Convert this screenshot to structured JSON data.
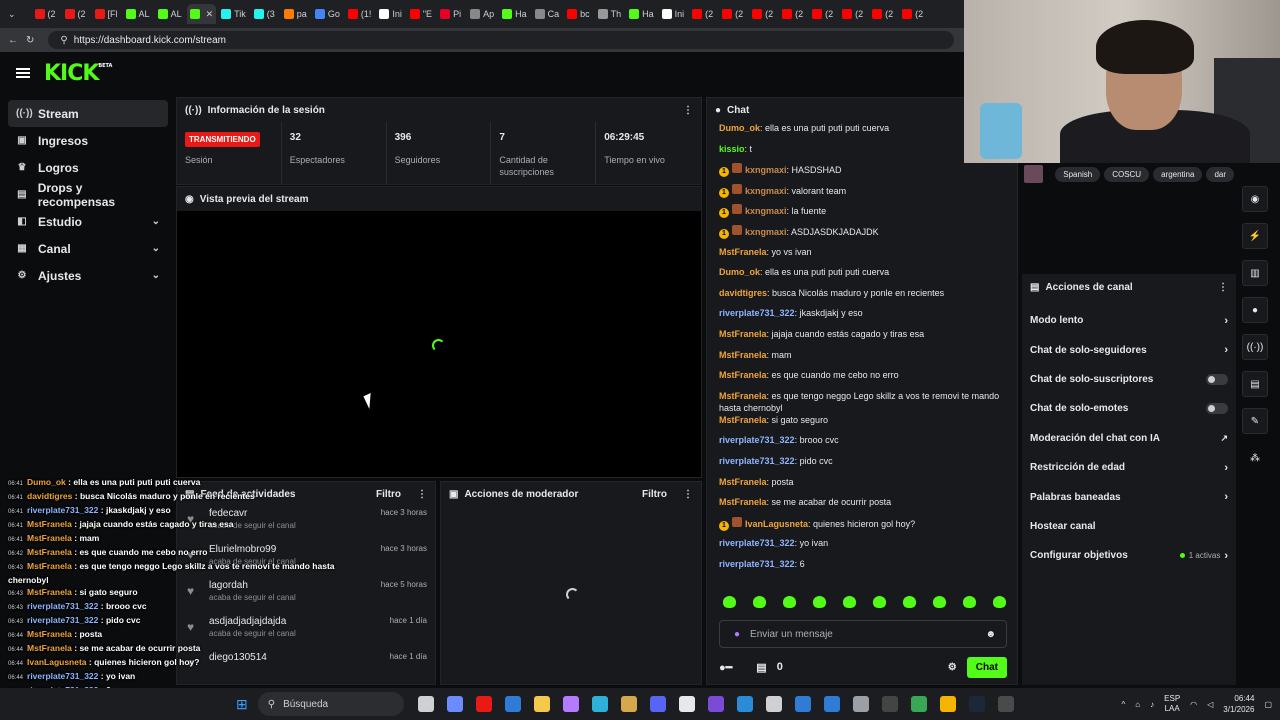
{
  "browser": {
    "tabs": [
      {
        "label": "(2",
        "color": "#e91916"
      },
      {
        "label": "(2",
        "color": "#e91916"
      },
      {
        "label": "[Fl",
        "color": "#e91916"
      },
      {
        "label": "AL",
        "color": "#53fc18"
      },
      {
        "label": "AL",
        "color": "#53fc18"
      },
      {
        "label": "",
        "color": "#53fc18"
      },
      {
        "label": "Tik",
        "color": "#25f4ee"
      },
      {
        "label": "(3",
        "color": "#25f4ee"
      },
      {
        "label": "pa",
        "color": "#ff7a00"
      },
      {
        "label": "Go",
        "color": "#4285f4"
      },
      {
        "label": "(1!",
        "color": "#ff0000"
      },
      {
        "label": "Ini",
        "color": "#ffffff"
      },
      {
        "label": "\"E",
        "color": "#ff0000"
      },
      {
        "label": "Pi",
        "color": "#e60023"
      },
      {
        "label": "Ap",
        "color": "#888888"
      },
      {
        "label": "Ha",
        "color": "#53fc18"
      },
      {
        "label": "Ca",
        "color": "#888888"
      },
      {
        "label": "bc",
        "color": "#ff0000"
      },
      {
        "label": "Th",
        "color": "#999999"
      },
      {
        "label": "Ha",
        "color": "#53fc18"
      },
      {
        "label": "Ini",
        "color": "#ffffff"
      },
      {
        "label": "(2",
        "color": "#ff0000"
      },
      {
        "label": "(2",
        "color": "#ff0000"
      },
      {
        "label": "(2",
        "color": "#ff0000"
      },
      {
        "label": "(2",
        "color": "#ff0000"
      },
      {
        "label": "(2",
        "color": "#ff0000"
      },
      {
        "label": "(2",
        "color": "#ff0000"
      },
      {
        "label": "(2",
        "color": "#ff0000"
      },
      {
        "label": "(2",
        "color": "#ff0000"
      }
    ],
    "url": "https://dashboard.kick.com/stream"
  },
  "kick": {
    "logo": "KICK",
    "beta": "BETA"
  },
  "nav": {
    "items": [
      {
        "label": "Stream",
        "icon": "broadcast-icon",
        "glyph": "((·))",
        "chevron": false,
        "active": true
      },
      {
        "label": "Ingresos",
        "icon": "wallet-icon",
        "glyph": "▣",
        "chevron": false,
        "active": false
      },
      {
        "label": "Logros",
        "icon": "trophy-icon",
        "glyph": "♛",
        "chevron": false,
        "active": false
      },
      {
        "label": "Drops y recompensas",
        "icon": "gift-icon",
        "glyph": "▤",
        "chevron": false,
        "active": false
      },
      {
        "label": "Estudio",
        "icon": "studio-icon",
        "glyph": "◧",
        "chevron": true,
        "active": false
      },
      {
        "label": "Canal",
        "icon": "channel-icon",
        "glyph": "▦",
        "chevron": true,
        "active": false
      },
      {
        "label": "Ajustes",
        "icon": "gear-icon",
        "glyph": "⚙",
        "chevron": true,
        "active": false
      }
    ]
  },
  "session": {
    "title": "Información de la sesión",
    "stats": [
      {
        "value": "TRANSMITIENDO",
        "label": "Sesión",
        "is_badge": true
      },
      {
        "value": "32",
        "label": "Espectadores",
        "is_badge": false
      },
      {
        "value": "396",
        "label": "Seguidores",
        "is_badge": false
      },
      {
        "value": "7",
        "label": "Cantidad de suscripciones",
        "is_badge": false
      },
      {
        "value": "06:29:45",
        "label": "Tiempo en vivo",
        "is_badge": false
      }
    ]
  },
  "preview": {
    "title": "Vista previa del stream"
  },
  "activity": {
    "title": "Feed de actividades",
    "filter": "Filtro",
    "rows": [
      {
        "name": "fedecavr",
        "sub": "acaba de seguir el canal",
        "time": "hace 3 horas"
      },
      {
        "name": "Elurielmobro99",
        "sub": "acaba de seguir el canal",
        "time": "hace 3 horas"
      },
      {
        "name": "lagordah",
        "sub": "acaba de seguir el canal",
        "time": "hace 5 horas"
      },
      {
        "name": "asdjadjadjajdajda",
        "sub": "acaba de seguir el canal",
        "time": "hace 1 día"
      },
      {
        "name": "diego130514",
        "sub": "",
        "time": "hace 1 día"
      }
    ]
  },
  "mod": {
    "title": "Acciones de moderador",
    "filter": "Filtro"
  },
  "chat": {
    "title": "Chat",
    "messages": [
      {
        "user": "Dumo_ok",
        "color": "#f0a43a",
        "text": "ella es una puti puti puti cuerva",
        "badges": false
      },
      {
        "user": "kissio",
        "color": "#53fc18",
        "text": "t",
        "badges": false
      },
      {
        "user": "kxngmaxi",
        "color": "#c98b4b",
        "text": "HASDSHAD",
        "badges": true
      },
      {
        "user": "kxngmaxi",
        "color": "#c98b4b",
        "text": "valorant team",
        "badges": true
      },
      {
        "user": "kxngmaxi",
        "color": "#c98b4b",
        "text": "la fuente",
        "badges": true
      },
      {
        "user": "kxngmaxi",
        "color": "#c98b4b",
        "text": "ASDJASDKJADAJDK",
        "badges": true
      },
      {
        "user": "MstFranela",
        "color": "#f0a43a",
        "text": "yo vs ivan",
        "badges": false
      },
      {
        "user": "Dumo_ok",
        "color": "#f0a43a",
        "text": "ella es una puti puti puti cuerva",
        "badges": false
      },
      {
        "user": "davidtigres",
        "color": "#f0a43a",
        "text": "busca Nicolás maduro y ponle en recientes",
        "badges": false
      },
      {
        "user": "riverplate731_322",
        "color": "#8fb4ff",
        "text": "jkaskdjakj y eso",
        "badges": false
      },
      {
        "user": "MstFranela",
        "color": "#f0a43a",
        "text": "jajaja cuando estás cagado y tiras esa",
        "badges": false
      },
      {
        "user": "MstFranela",
        "color": "#f0a43a",
        "text": "mam",
        "badges": false
      },
      {
        "user": "MstFranela",
        "color": "#f0a43a",
        "text": "es que cuando me cebo no erro",
        "badges": false
      },
      {
        "user": "MstFranela",
        "color": "#f0a43a",
        "text": "es que tengo neggo Lego skillz a vos te removi te mando hasta chernobyl",
        "badges": false
      },
      {
        "user": "MstFranela",
        "color": "#f0a43a",
        "text": "si gato seguro",
        "badges": false
      },
      {
        "user": "riverplate731_322",
        "color": "#8fb4ff",
        "text": "brooo cvc",
        "badges": false
      },
      {
        "user": "riverplate731_322",
        "color": "#8fb4ff",
        "text": "pido cvc",
        "badges": false
      },
      {
        "user": "MstFranela",
        "color": "#f0a43a",
        "text": "posta",
        "badges": false
      },
      {
        "user": "MstFranela",
        "color": "#f0a43a",
        "text": "se me acabar de ocurrir posta",
        "badges": false
      },
      {
        "user": "IvanLagusneta",
        "color": "#f0a43a",
        "text": "quienes hicieron gol hoy?",
        "badges": true
      },
      {
        "user": "riverplate731_322",
        "color": "#8fb4ff",
        "text": "yo ivan",
        "badges": false
      },
      {
        "user": "riverplate731_322",
        "color": "#8fb4ff",
        "text": "6",
        "badges": false
      }
    ],
    "placeholder": "Enviar un mensaje",
    "count": "0",
    "send": "Chat"
  },
  "tags": [
    "Spanish",
    "COSCU",
    "argentina",
    "dar"
  ],
  "channel": {
    "title": "Acciones de canal",
    "rows": [
      {
        "label": "Modo lento",
        "kind": "chevron",
        "extra": ""
      },
      {
        "label": "Chat de solo-seguidores",
        "kind": "chevron",
        "extra": ""
      },
      {
        "label": "Chat de solo-suscriptores",
        "kind": "toggle",
        "extra": ""
      },
      {
        "label": "Chat de solo-emotes",
        "kind": "toggle",
        "extra": ""
      },
      {
        "label": "Moderación del chat con IA",
        "kind": "external",
        "extra": ""
      },
      {
        "label": "Restricción de edad",
        "kind": "chevron",
        "extra": ""
      },
      {
        "label": "Palabras baneadas",
        "kind": "chevron",
        "extra": ""
      },
      {
        "label": "Hostear canal",
        "kind": "none",
        "extra": ""
      },
      {
        "label": "Configurar objetivos",
        "kind": "chevron",
        "extra": "1 activas"
      }
    ]
  },
  "rail": [
    {
      "icon": "camera-icon",
      "glyph": "◉"
    },
    {
      "icon": "lightning-icon",
      "glyph": "⚡"
    },
    {
      "icon": "notes-icon",
      "glyph": "▥"
    },
    {
      "icon": "chat-bubble-icon",
      "glyph": "●"
    },
    {
      "icon": "broadcast-icon",
      "glyph": "((·))"
    },
    {
      "icon": "store-icon",
      "glyph": "▤"
    },
    {
      "icon": "wrench-icon",
      "glyph": "✎"
    },
    {
      "icon": "palette-icon",
      "glyph": "⁂"
    }
  ],
  "overlay": {
    "lines": [
      {
        "time": "06:41",
        "user": "Dumo_ok",
        "color": "#f0a43a",
        "text": "ella es una puti puti puti cuerva"
      },
      {
        "time": "06:41",
        "user": "davidtigres",
        "color": "#f0a43a",
        "text": "busca Nicolás maduro y ponle en recientes"
      },
      {
        "time": "06:41",
        "user": "riverplate731_322",
        "color": "#8fb4ff",
        "text": "jkaskdjakj y eso"
      },
      {
        "time": "06:41",
        "user": "MstFranela",
        "color": "#f0a43a",
        "text": "jajaja cuando estás cagado y tiras esa"
      },
      {
        "time": "06:41",
        "user": "MstFranela",
        "color": "#f0a43a",
        "text": "mam"
      },
      {
        "time": "06:42",
        "user": "MstFranela",
        "color": "#f0a43a",
        "text": "es que cuando me cebo no erro"
      },
      {
        "time": "06:43",
        "user": "MstFranela",
        "color": "#f0a43a",
        "text": "es que tengo neggo Lego skillz a vos te removi te mando hasta"
      },
      {
        "time": "",
        "user": "",
        "color": "#ffffff",
        "text": "chernobyl"
      },
      {
        "time": "06:43",
        "user": "MstFranela",
        "color": "#f0a43a",
        "text": "si gato seguro"
      },
      {
        "time": "06:43",
        "user": "riverplate731_322",
        "color": "#8fb4ff",
        "text": "brooo cvc"
      },
      {
        "time": "06:43",
        "user": "riverplate731_322",
        "color": "#8fb4ff",
        "text": "pido cvc"
      },
      {
        "time": "06:44",
        "user": "MstFranela",
        "color": "#f0a43a",
        "text": "posta"
      },
      {
        "time": "06:44",
        "user": "MstFranela",
        "color": "#f0a43a",
        "text": "se me acabar de ocurrir posta"
      },
      {
        "time": "06:44",
        "user": "IvanLagusneta",
        "color": "#f0a43a",
        "text": "quienes hicieron gol hoy?"
      },
      {
        "time": "06:44",
        "user": "riverplate731_322",
        "color": "#8fb4ff",
        "text": "yo ivan"
      },
      {
        "time": "06:44",
        "user": "riverplate731_322",
        "color": "#8fb4ff",
        "text": "6"
      }
    ]
  },
  "taskbar": {
    "search": "Búsqueda",
    "icons": [
      {
        "name": "task-view-icon",
        "color": "#cfd0d3"
      },
      {
        "name": "copilot-icon",
        "color": "#6a8cff"
      },
      {
        "name": "opera-icon",
        "color": "#e91916"
      },
      {
        "name": "store-icon",
        "color": "#2f7bd6"
      },
      {
        "name": "folder-icon",
        "color": "#f2c94c"
      },
      {
        "name": "pen-icon",
        "color": "#b57bff"
      },
      {
        "name": "edge-icon",
        "color": "#2bb2d6"
      },
      {
        "name": "vortex-icon",
        "color": "#d4a84b"
      },
      {
        "name": "discord-icon",
        "color": "#5865f2"
      },
      {
        "name": "capcut-icon",
        "color": "#e8e8ea"
      },
      {
        "name": "app-icon",
        "color": "#7b4bd6"
      },
      {
        "name": "vscode-icon",
        "color": "#2a8bd6"
      },
      {
        "name": "notepad-icon",
        "color": "#cfd0d3"
      },
      {
        "name": "mail-icon",
        "color": "#2f7bd6"
      },
      {
        "name": "photos-icon",
        "color": "#2f7bd6"
      },
      {
        "name": "settings-icon",
        "color": "#9aa0a6"
      },
      {
        "name": "terminal-icon",
        "color": "#444"
      },
      {
        "name": "globe-icon",
        "color": "#3aa757"
      },
      {
        "name": "chrome-icon",
        "color": "#f4b400"
      },
      {
        "name": "steam-icon",
        "color": "#1b2838"
      },
      {
        "name": "calculator-icon",
        "color": "#4a4a4a"
      }
    ],
    "lang": "ESP",
    "lang2": "LAA",
    "time": "06:44",
    "date": "3/1/2026"
  }
}
